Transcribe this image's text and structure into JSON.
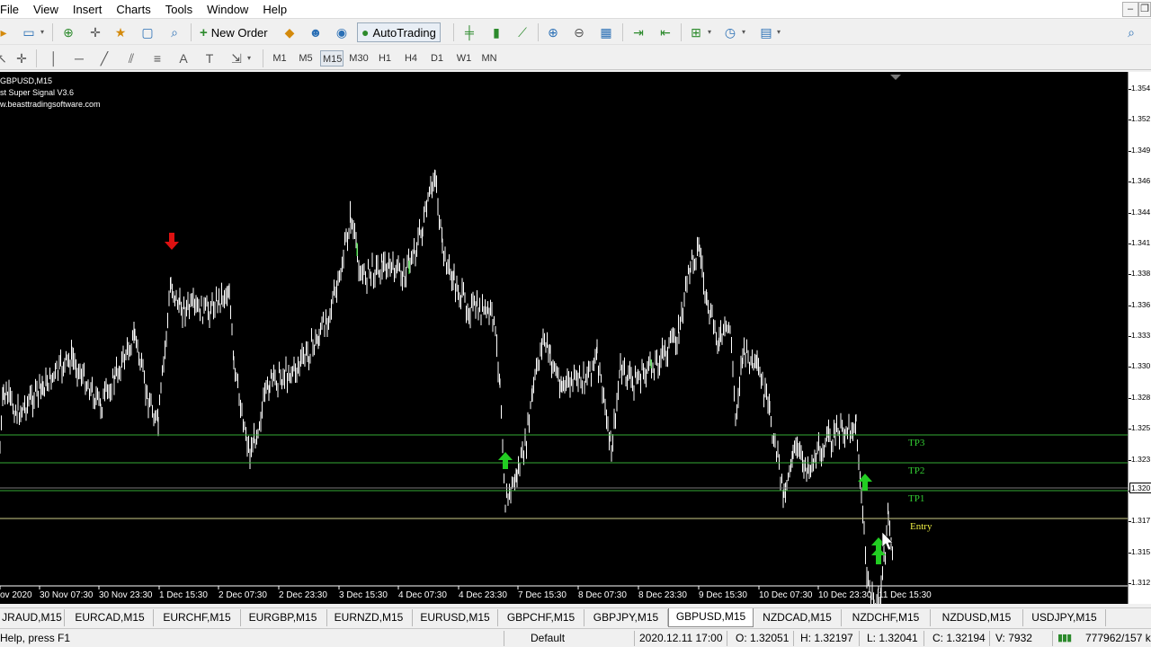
{
  "menu": [
    "File",
    "View",
    "Insert",
    "Charts",
    "Tools",
    "Window",
    "Help"
  ],
  "toolbar": {
    "new_order": "New Order",
    "auto_trading": "AutoTrading"
  },
  "timeframes": [
    "M1",
    "M5",
    "M15",
    "M30",
    "H1",
    "H4",
    "D1",
    "W1",
    "MN"
  ],
  "active_timeframe": "M15",
  "chart": {
    "symbol_line": "GBPUSD,M15",
    "indicator_line": "st Super Signal V3.6",
    "website_line": "w.beasttradingsoftware.com",
    "level_labels": {
      "tp3": "TP3",
      "tp2": "TP2",
      "tp1": "TP1",
      "entry": "Entry"
    },
    "price_labels": [
      "1.354",
      "1.352",
      "1.349",
      "1.346",
      "1.344",
      "1.341",
      "1.338",
      "1.336",
      "1.333",
      "1.330",
      "1.328",
      "1.325",
      "1.323",
      "1.320",
      "1.317",
      "1.315",
      "1.312"
    ],
    "current_price": "1.320",
    "time_labels": [
      "ov 2020",
      "30 Nov 07:30",
      "30 Nov 23:30",
      "1 Dec 15:30",
      "2 Dec 07:30",
      "2 Dec 23:30",
      "3 Dec 15:30",
      "4 Dec 07:30",
      "4 Dec 23:30",
      "7 Dec 15:30",
      "8 Dec 07:30",
      "8 Dec 23:30",
      "9 Dec 15:30",
      "10 Dec 07:30",
      "10 Dec 23:30",
      "11 Dec 15:30"
    ],
    "colors": {
      "background": "#000000",
      "bars": "#ffffff",
      "buy_arrow": "#22cc22",
      "sell_arrow": "#dd1111",
      "tp_line": "#33aa33",
      "entry_line": "#cccc88",
      "tp_text": "#33cc33",
      "entry_text": "#eeee44"
    }
  },
  "tabs": [
    "JRAUD,M15",
    "EURCAD,M15",
    "EURCHF,M15",
    "EURGBP,M15",
    "EURNZD,M15",
    "EURUSD,M15",
    "GBPCHF,M15",
    "GBPJPY,M15",
    "GBPUSD,M15",
    "NZDCAD,M15",
    "NZDCHF,M15",
    "NZDUSD,M15",
    "USDJPY,M15"
  ],
  "active_tab": "GBPUSD,M15",
  "status": {
    "help": "Help, press F1",
    "profile": "Default",
    "datetime": "2020.12.11 17:00",
    "open": "O: 1.32051",
    "high": "H: 1.32197",
    "low": "L: 1.32041",
    "close": "C: 1.32194",
    "volume": "V: 7932",
    "traffic": "777962/157 k"
  }
}
